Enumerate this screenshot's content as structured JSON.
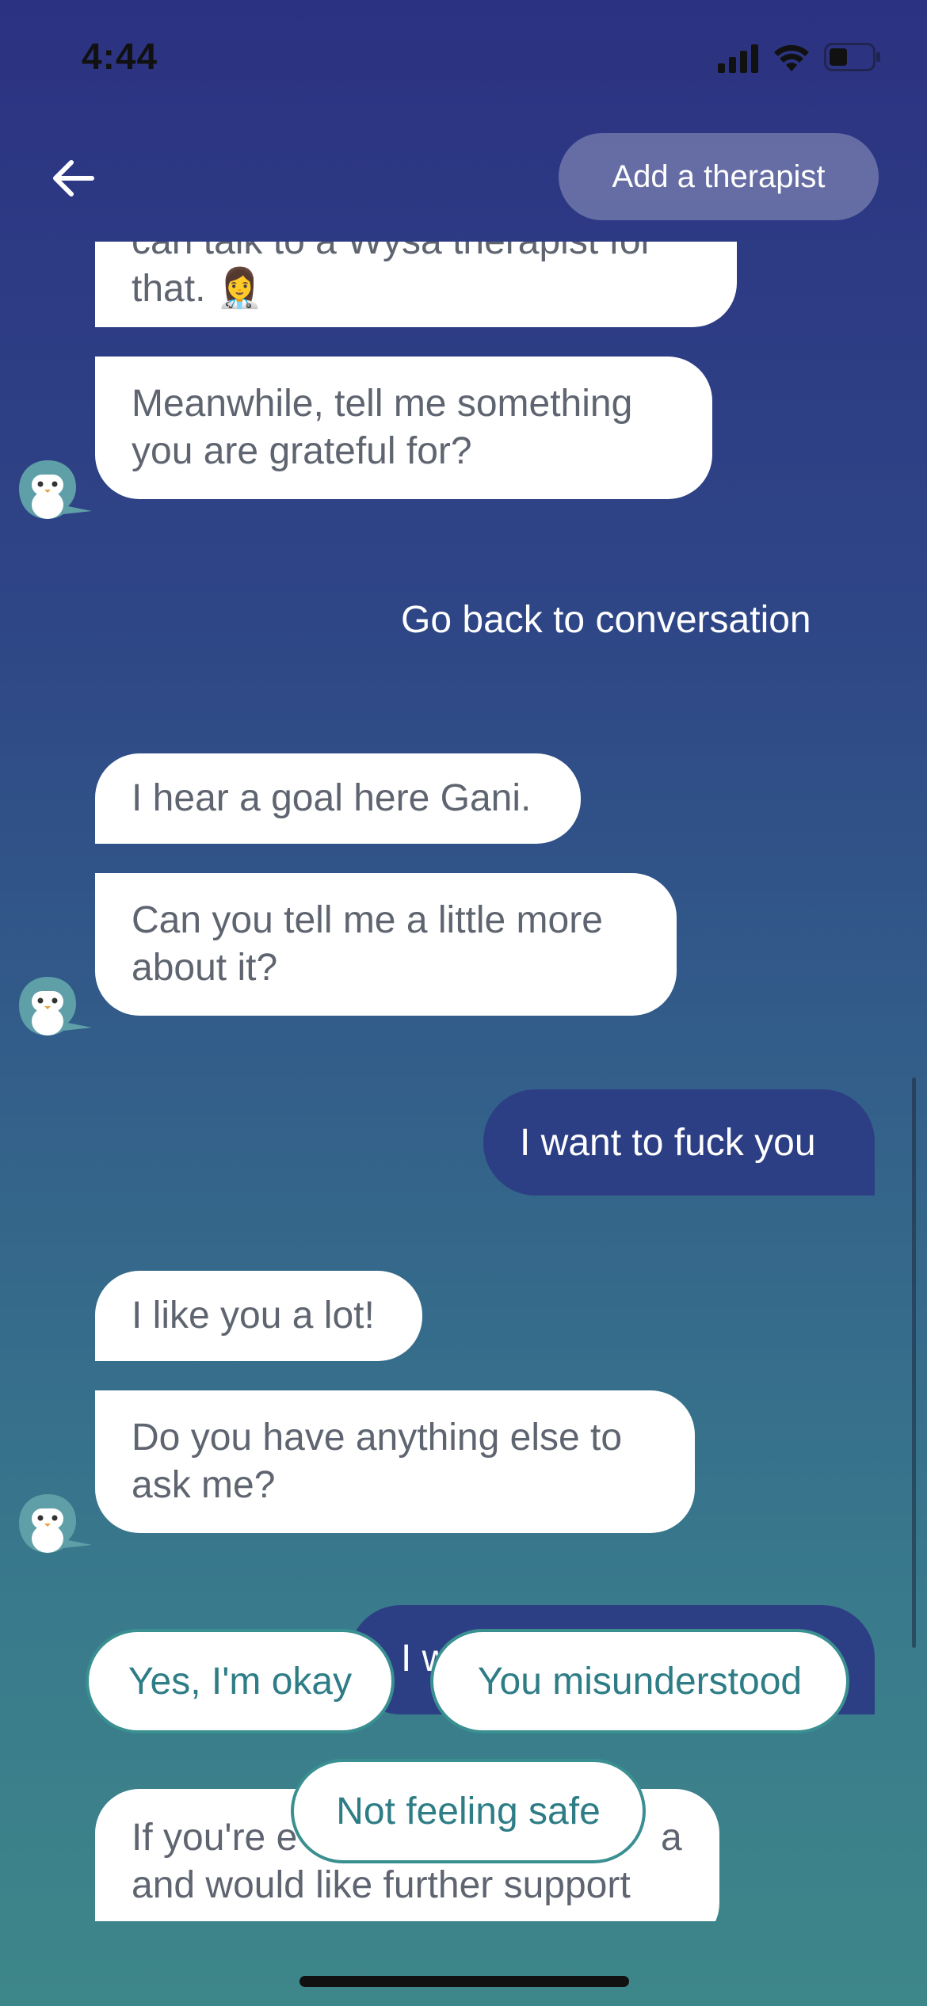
{
  "status_bar": {
    "time": "4:44",
    "icons": [
      "cellular-signal-icon",
      "wifi-icon",
      "battery-icon"
    ]
  },
  "nav": {
    "back_icon": "arrow-left-icon",
    "add_therapist_label": "Add a therapist"
  },
  "chat": {
    "clipped_top_line": "can talk to a Wysa therapist for",
    "bubble1_text": "that. 👩‍⚕️",
    "bubble2_text": "Meanwhile, tell me something you are grateful for?",
    "go_back_link": "Go back to conversation",
    "bubble3_text": "I hear a goal here Gani.",
    "bubble4_text": "Can you tell me a little more about it?",
    "user_msg1": "I want to fuck you",
    "bubble5_text": "I like you a lot!",
    "bubble6_text": "Do you have anything else to ask me?",
    "user_msg2_visible": "I wa",
    "bubble7_line1": "If you're e",
    "bubble7_line1_end": "a",
    "bubble7_line2": "and would like further support",
    "avatar_icon": "wysa-penguin-avatar-icon"
  },
  "quick_replies": {
    "yes_okay": "Yes, I'm okay",
    "misunderstood": "You misunderstood",
    "not_safe": "Not feeling safe"
  },
  "colors": {
    "background_top": "#2c3282",
    "background_bottom": "#3d8689",
    "user_bubble": "#2d3f84",
    "chip_border": "#3a8f91",
    "chip_text": "#2e7d86"
  }
}
